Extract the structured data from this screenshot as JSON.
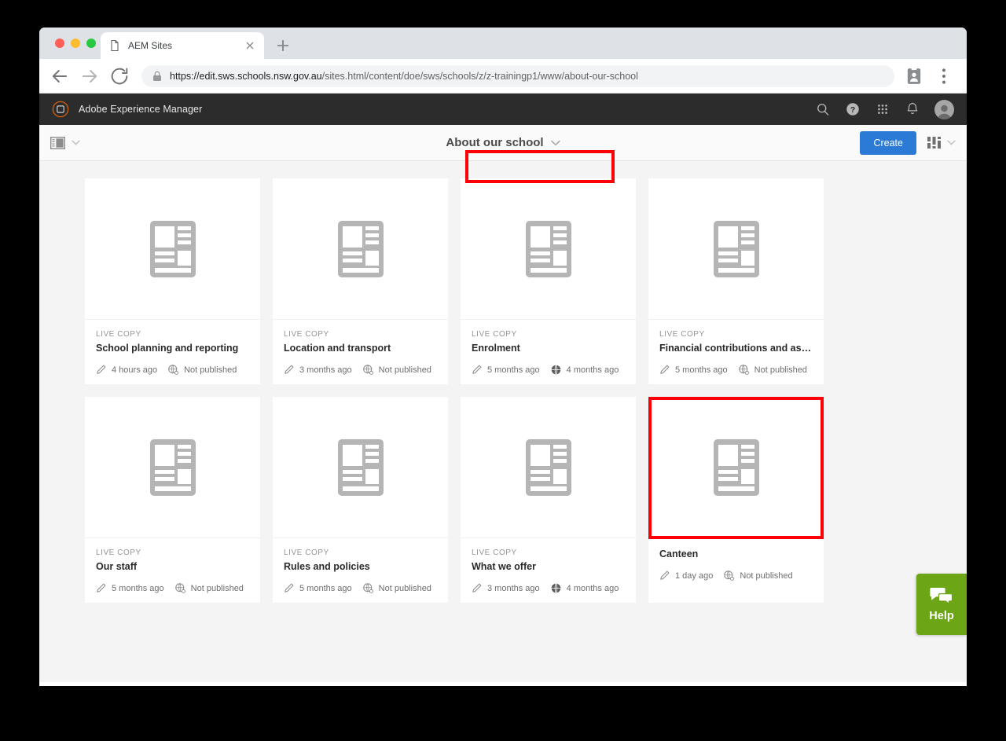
{
  "browser": {
    "tab": {
      "title": "AEM Sites",
      "favicon_icon": "page-icon",
      "close_icon": "close-icon"
    },
    "new_tab_icon": "plus-icon",
    "back_icon": "back-arrow-icon",
    "forward_icon": "forward-arrow-icon",
    "reload_icon": "reload-icon",
    "lock_icon": "lock-icon",
    "url_host": "https://edit.sws.schools.nsw.gov.au",
    "url_path": "/sites.html/content/doe/sws/schools/z/z-trainingp1/www/about-our-school",
    "profile_icon": "profile-card-icon",
    "menu_icon": "three-dot-menu-icon"
  },
  "aem_header": {
    "logo_icon": "adobe-experience-manager-logo",
    "title": "Adobe Experience Manager",
    "actions": [
      {
        "icon": "search-icon"
      },
      {
        "icon": "help-question-icon"
      },
      {
        "icon": "app-grid-icon"
      },
      {
        "icon": "bell-notification-icon"
      },
      {
        "icon": "avatar-icon"
      }
    ]
  },
  "toolbar": {
    "rail_toggle_icon": "side-panel-icon",
    "rail_chevron_icon": "chevron-down-icon",
    "page_title": "About our school",
    "page_title_chevron_icon": "chevron-down-icon",
    "create_label": "Create",
    "view_switch_icon": "card-view-icon",
    "view_switch_chevron_icon": "chevron-down-icon"
  },
  "content": {
    "live_copy_label": "LIVE COPY",
    "thumbnail_icon": "page-layout-thumbnail-icon",
    "modified_icon": "pencil-edit-icon",
    "published_icon": "globe-published-icon",
    "unpublished_icon": "globe-unpublished-icon",
    "cards": [
      {
        "live_copy": true,
        "name": "School planning and reporting",
        "modified": "4 hours ago",
        "published": "Not published",
        "is_published": false,
        "highlighted": false
      },
      {
        "live_copy": true,
        "name": "Location and transport",
        "modified": "3 months ago",
        "published": "Not published",
        "is_published": false,
        "highlighted": false
      },
      {
        "live_copy": true,
        "name": "Enrolment",
        "modified": "5 months ago",
        "published": "4 months ago",
        "is_published": true,
        "highlighted": false
      },
      {
        "live_copy": true,
        "name": "Financial contributions and assistance",
        "modified": "5 months ago",
        "published": "Not published",
        "is_published": false,
        "highlighted": false
      },
      {
        "live_copy": true,
        "name": "Our staff",
        "modified": "5 months ago",
        "published": "Not published",
        "is_published": false,
        "highlighted": false
      },
      {
        "live_copy": true,
        "name": "Rules and policies",
        "modified": "5 months ago",
        "published": "Not published",
        "is_published": false,
        "highlighted": false
      },
      {
        "live_copy": true,
        "name": "What we offer",
        "modified": "3 months ago",
        "published": "4 months ago",
        "is_published": true,
        "highlighted": false
      },
      {
        "live_copy": false,
        "name": "Canteen",
        "modified": "1 day ago",
        "published": "Not published",
        "is_published": false,
        "highlighted": true
      }
    ]
  },
  "help_widget": {
    "label": "Help",
    "icon": "chat-bubbles-icon"
  },
  "colors": {
    "accent_blue": "#2b7bd6",
    "annotation_red": "#fb0007",
    "help_green": "#6ca516",
    "header_dark": "#2c2c2c"
  }
}
